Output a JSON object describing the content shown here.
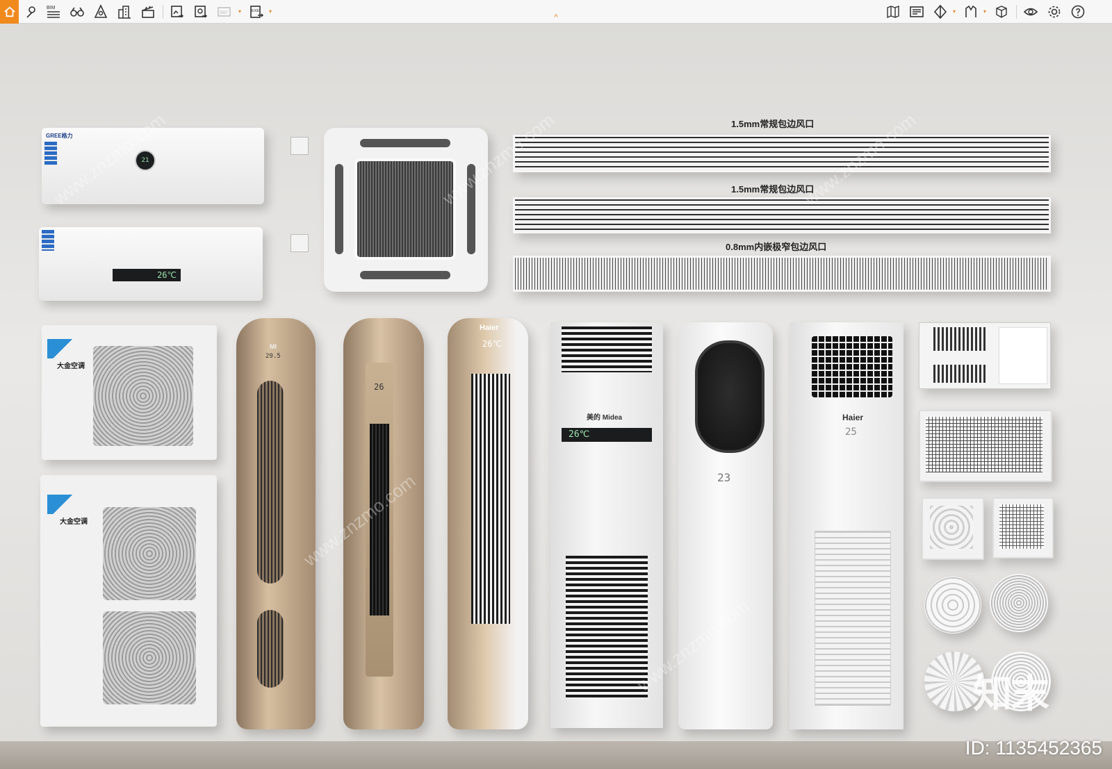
{
  "toolbar": {
    "left_icons": [
      "home-icon",
      "location-pin-icon",
      "bim-icon",
      "binoculars-icon",
      "shield-measure-icon",
      "buildings-icon",
      "clapperboard-icon",
      "export-image-icon",
      "export-panorama-icon",
      "360-view-icon",
      "exe-export-icon"
    ],
    "right_icons": [
      "map-icon",
      "cad-icon",
      "section-icon",
      "elevation-icon",
      "cube-tool-icon",
      "eye-icon",
      "gear-icon",
      "help-icon"
    ],
    "bim_label": "BIM",
    "pano_label": "360°",
    "exe_label": "EXE",
    "collapse_glyph": "^",
    "accent_color": "#f08a1d"
  },
  "scene": {
    "grille_labels": [
      "1.5mm常规包边风口",
      "1.5mm常规包边风口",
      "0.8mm内嵌极窄包边风口"
    ],
    "wall_unit_1_brand": "GREE格力",
    "wall_unit_1_display": "21",
    "wall_unit_2_display": "26℃",
    "outdoor_brand": "大金空调",
    "tower_1_brand": "MI",
    "tower_1_display": "29.5",
    "tower_2_display": "26",
    "tower_3_brand": "Haier",
    "tower_3_display": "26℃",
    "tower_4_brand": "美的 Midea",
    "tower_4_display": "26℃",
    "tower_5_display": "23",
    "tower_6_brand": "Haier",
    "tower_6_display": "25",
    "watermark_text": "www.znzmo.com",
    "watermark_logo": "知末",
    "asset_id": "ID: 1135452365"
  }
}
